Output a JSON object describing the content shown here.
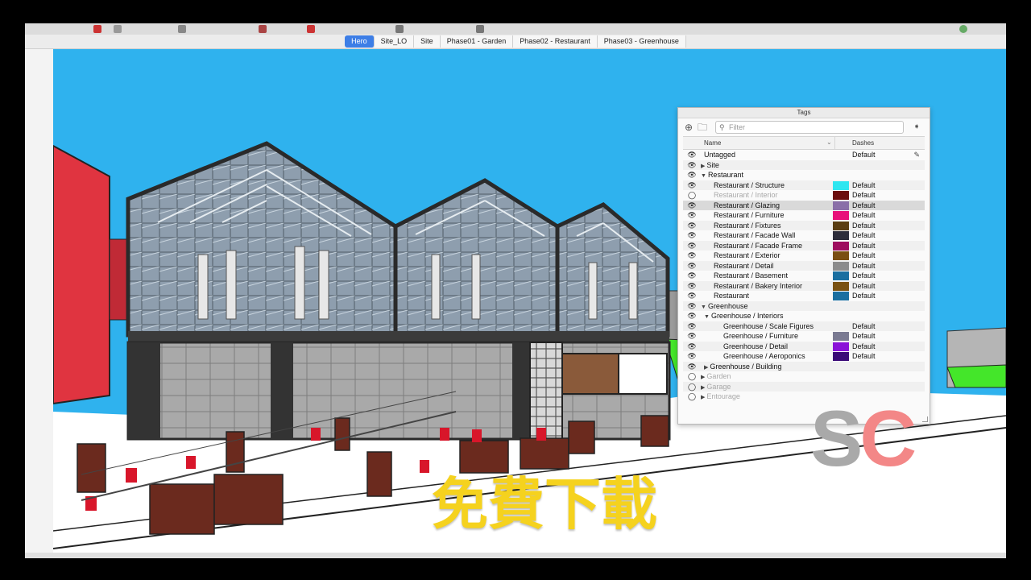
{
  "scenes": {
    "tabs": [
      "Hero",
      "Site_LO",
      "Site",
      "Phase01 - Garden",
      "Phase02 - Restaurant",
      "Phase03 - Greenhouse"
    ],
    "active": "Hero"
  },
  "tags_panel": {
    "title": "Tags",
    "filter_placeholder": "Filter",
    "columns": {
      "name": "Name",
      "dashes": "Dashes"
    },
    "rows": [
      {
        "label": "Untagged",
        "indent": 1,
        "expander": "",
        "visible": true,
        "color": "",
        "dash": "Default"
      },
      {
        "label": "Site",
        "indent": 0,
        "expander": "▶",
        "visible": true,
        "color": "",
        "dash": ""
      },
      {
        "label": "Restaurant",
        "indent": 0,
        "expander": "▼",
        "visible": true,
        "color": "",
        "dash": ""
      },
      {
        "label": "Restaurant / Structure",
        "indent": 2,
        "expander": "",
        "visible": true,
        "color": "#2ee6f0",
        "dash": "Default"
      },
      {
        "label": "Restaurant / Interior",
        "indent": 2,
        "expander": "",
        "visible": false,
        "color": "#6b0d0d",
        "dash": "Default"
      },
      {
        "label": "Restaurant / Glazing",
        "indent": 2,
        "expander": "",
        "visible": true,
        "color": "#8a6fa8",
        "dash": "Default",
        "selected": true
      },
      {
        "label": "Restaurant / Furniture",
        "indent": 2,
        "expander": "",
        "visible": true,
        "color": "#e8127a",
        "dash": "Default"
      },
      {
        "label": "Restaurant / Fixtures",
        "indent": 2,
        "expander": "",
        "visible": true,
        "color": "#5a3d12",
        "dash": "Default"
      },
      {
        "label": "Restaurant / Facade Wall",
        "indent": 2,
        "expander": "",
        "visible": true,
        "color": "#2d2d3a",
        "dash": "Default"
      },
      {
        "label": "Restaurant / Facade Frame",
        "indent": 2,
        "expander": "",
        "visible": true,
        "color": "#9e0d5e",
        "dash": "Default"
      },
      {
        "label": "Restaurant / Exterior",
        "indent": 2,
        "expander": "",
        "visible": true,
        "color": "#7a4e12",
        "dash": "Default"
      },
      {
        "label": "Restaurant / Detail",
        "indent": 2,
        "expander": "",
        "visible": true,
        "color": "#8c8c8c",
        "dash": "Default"
      },
      {
        "label": "Restaurant / Basement",
        "indent": 2,
        "expander": "",
        "visible": true,
        "color": "#1a6fa0",
        "dash": "Default"
      },
      {
        "label": "Restaurant / Bakery Interior",
        "indent": 2,
        "expander": "",
        "visible": true,
        "color": "#7a5212",
        "dash": "Default"
      },
      {
        "label": "Restaurant",
        "indent": 2,
        "expander": "",
        "visible": true,
        "color": "#1a6fa0",
        "dash": "Default"
      },
      {
        "label": "Greenhouse",
        "indent": 0,
        "expander": "▼",
        "visible": true,
        "color": "",
        "dash": ""
      },
      {
        "label": "Greenhouse / Interiors",
        "indent": 1,
        "expander": "▼",
        "visible": true,
        "color": "",
        "dash": ""
      },
      {
        "label": "Greenhouse / Scale Figures",
        "indent": 3,
        "expander": "",
        "visible": true,
        "color": "",
        "dash": "Default"
      },
      {
        "label": "Greenhouse / Furniture",
        "indent": 3,
        "expander": "",
        "visible": true,
        "color": "#7a7a92",
        "dash": "Default"
      },
      {
        "label": "Greenhouse / Detail",
        "indent": 3,
        "expander": "",
        "visible": true,
        "color": "#8a12d8",
        "dash": "Default"
      },
      {
        "label": "Greenhouse / Aeroponics",
        "indent": 3,
        "expander": "",
        "visible": true,
        "color": "#3a0a78",
        "dash": "Default"
      },
      {
        "label": "Greenhouse / Building",
        "indent": 1,
        "expander": "▶",
        "visible": true,
        "color": "",
        "dash": ""
      },
      {
        "label": "Garden",
        "indent": 0,
        "expander": "▶",
        "visible": false,
        "color": "",
        "dash": ""
      },
      {
        "label": "Garage",
        "indent": 0,
        "expander": "▶",
        "visible": false,
        "color": "",
        "dash": ""
      },
      {
        "label": "Entourage",
        "indent": 0,
        "expander": "▶",
        "visible": false,
        "color": "",
        "dash": ""
      }
    ]
  },
  "watermark": {
    "sc_s": "S",
    "sc_c": "C",
    "cn": "免費下載"
  }
}
